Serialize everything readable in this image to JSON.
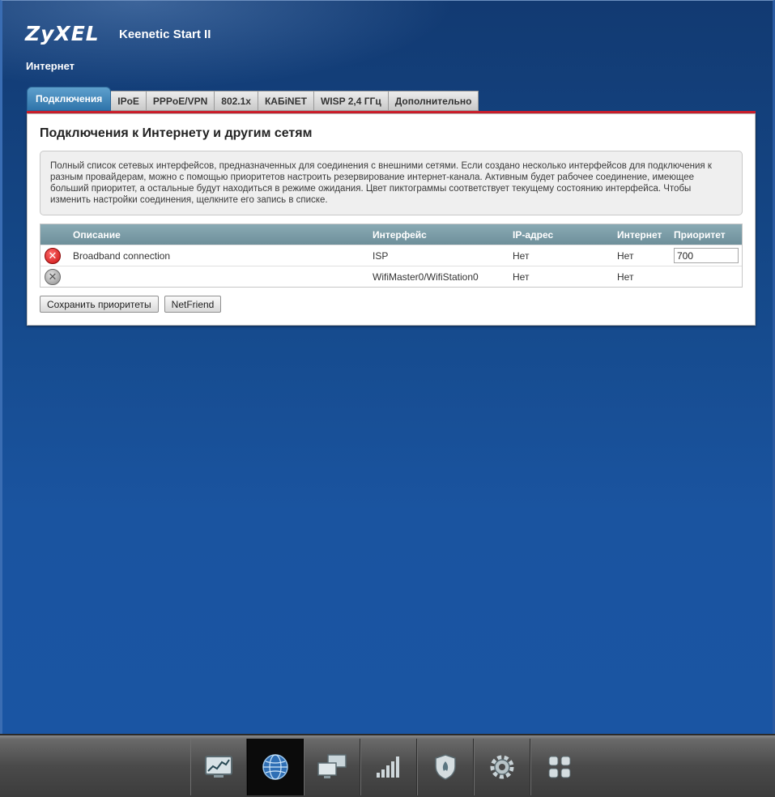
{
  "header": {
    "brand": "ZyXEL",
    "model": "Keenetic Start II",
    "section": "Интернет"
  },
  "tabs": [
    {
      "label": "Подключения",
      "active": true
    },
    {
      "label": "IPoE"
    },
    {
      "label": "PPPoE/VPN"
    },
    {
      "label": "802.1x"
    },
    {
      "label": "КАБiNET"
    },
    {
      "label": "WISP 2,4 ГГц"
    },
    {
      "label": "Дополнительно"
    }
  ],
  "panel": {
    "title": "Подключения к Интернету и другим сетям",
    "info": "Полный список сетевых интерфейсов, предназначенных для соединения с внешними сетями. Если создано несколько интерфейсов для подключения к разным провайдерам, можно с помощью приоритетов настроить резервирование интернет-канала. Активным будет рабочее соединение, имеющее больший приоритет, а остальные будут находиться в режиме ожидания. Цвет пиктограммы соответствует текущему состоянию интерфейса. Чтобы изменить настройки соединения, щелкните его запись в списке."
  },
  "table": {
    "columns": {
      "description": "Описание",
      "interface": "Интерфейс",
      "ip": "IP-адрес",
      "internet": "Интернет",
      "priority": "Приоритет"
    },
    "rows": [
      {
        "status": "red",
        "status_icon": "error-icon",
        "description": "Broadband connection",
        "interface": "ISP",
        "ip": "Нет",
        "internet": "Нет",
        "priority": "700"
      },
      {
        "status": "gray",
        "status_icon": "disabled-icon",
        "description": "",
        "interface": "WifiMaster0/WifiStation0",
        "ip": "Нет",
        "internet": "Нет",
        "priority": ""
      }
    ]
  },
  "buttons": {
    "save_priorities": "Сохранить приоритеты",
    "netfriend": "NetFriend"
  },
  "dock": [
    {
      "icon": "monitor-chart-icon"
    },
    {
      "icon": "globe-icon",
      "active": true
    },
    {
      "icon": "network-computers-icon"
    },
    {
      "icon": "wifi-signal-bars-icon"
    },
    {
      "icon": "shield-firewall-icon"
    },
    {
      "icon": "gear-icon"
    },
    {
      "icon": "grid-apps-icon"
    }
  ],
  "colors": {
    "accent_red": "#d21e2b",
    "tab_active": "#2f74aa",
    "table_header": "#7a9ba6"
  }
}
